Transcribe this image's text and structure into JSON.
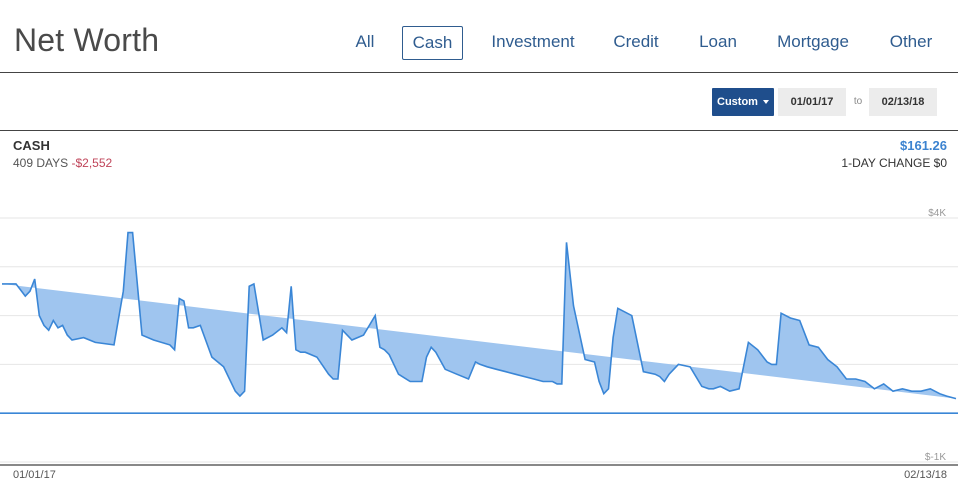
{
  "header": {
    "title": "Net Worth",
    "tabs": [
      {
        "label": "All",
        "active": false
      },
      {
        "label": "Cash",
        "active": true
      },
      {
        "label": "Investment",
        "active": false
      },
      {
        "label": "Credit",
        "active": false
      },
      {
        "label": "Loan",
        "active": false
      },
      {
        "label": "Mortgage",
        "active": false
      },
      {
        "label": "Other",
        "active": false
      }
    ]
  },
  "range": {
    "mode": "Custom",
    "start": "01/01/17",
    "to": "to",
    "end": "02/13/18"
  },
  "account": {
    "name": "CASH",
    "days": "409 DAYS",
    "change": "-$2,552",
    "value": "$161.26",
    "day_change": "1-DAY CHANGE $0"
  },
  "colors": {
    "accent": "#2f5c8f",
    "button": "#1f4e8c",
    "line": "#3a86d6",
    "fill": "#9fc5ef",
    "value": "#3c83d0",
    "negative": "#c0455a"
  },
  "chart_data": {
    "type": "area",
    "title": "",
    "xlabel": "",
    "ylabel": "",
    "ylim": [
      -1000,
      4000
    ],
    "y_tick_labels": [
      "$4K",
      "$-1K"
    ],
    "x_tick_labels": [
      "01/01/17",
      "02/13/18"
    ],
    "grid": true,
    "series": [
      {
        "x_days": [
          0,
          6,
          10,
          12,
          14,
          16,
          18,
          20,
          22,
          24,
          26,
          28,
          30,
          35,
          40,
          48,
          52,
          54,
          56,
          60,
          65,
          72,
          74,
          76,
          78,
          80,
          82,
          85,
          90,
          95,
          100,
          102,
          104,
          106,
          108,
          112,
          116,
          120,
          122,
          124,
          126,
          128,
          130,
          135,
          140,
          142,
          144,
          146,
          150,
          155,
          160,
          162,
          164,
          166,
          170,
          175,
          180,
          182,
          184,
          186,
          190,
          195,
          200,
          203,
          205,
          208,
          212,
          216,
          220,
          224,
          228,
          232,
          236,
          238,
          240,
          242,
          245,
          250,
          254,
          256,
          258,
          260,
          262,
          264,
          270,
          275,
          280,
          282,
          284,
          286,
          290,
          295,
          300,
          303,
          305,
          308,
          312,
          316,
          320,
          324,
          328,
          330,
          332,
          334,
          338,
          342,
          346,
          350,
          354,
          358,
          362,
          366,
          370,
          374,
          378,
          382,
          386,
          390,
          394,
          398,
          402,
          405,
          409
        ],
        "values": [
          2650,
          2650,
          2400,
          2500,
          2750,
          2000,
          1800,
          1700,
          1900,
          1750,
          1800,
          1600,
          1500,
          1550,
          1450,
          1400,
          2500,
          3700,
          3700,
          1600,
          1500,
          1400,
          1300,
          2350,
          2300,
          1750,
          1750,
          1800,
          1150,
          950,
          450,
          350,
          450,
          2600,
          2650,
          1500,
          1600,
          1750,
          1650,
          2600,
          1300,
          1250,
          1250,
          1150,
          800,
          700,
          700,
          1700,
          1500,
          1600,
          2000,
          1350,
          1300,
          1200,
          800,
          650,
          650,
          1150,
          1350,
          1250,
          900,
          800,
          700,
          1050,
          1000,
          950,
          900,
          850,
          800,
          750,
          700,
          650,
          650,
          600,
          600,
          3500,
          2200,
          1100,
          1050,
          650,
          400,
          500,
          1550,
          2150,
          2000,
          850,
          800,
          750,
          650,
          800,
          1000,
          950,
          550,
          500,
          500,
          550,
          450,
          500,
          1450,
          1300,
          1050,
          1000,
          1000,
          2050,
          1950,
          1900,
          1400,
          1350,
          1100,
          950,
          700,
          700,
          650,
          500,
          600,
          450,
          500,
          450,
          450,
          500,
          400,
          350,
          300,
          250,
          250
        ]
      }
    ]
  }
}
